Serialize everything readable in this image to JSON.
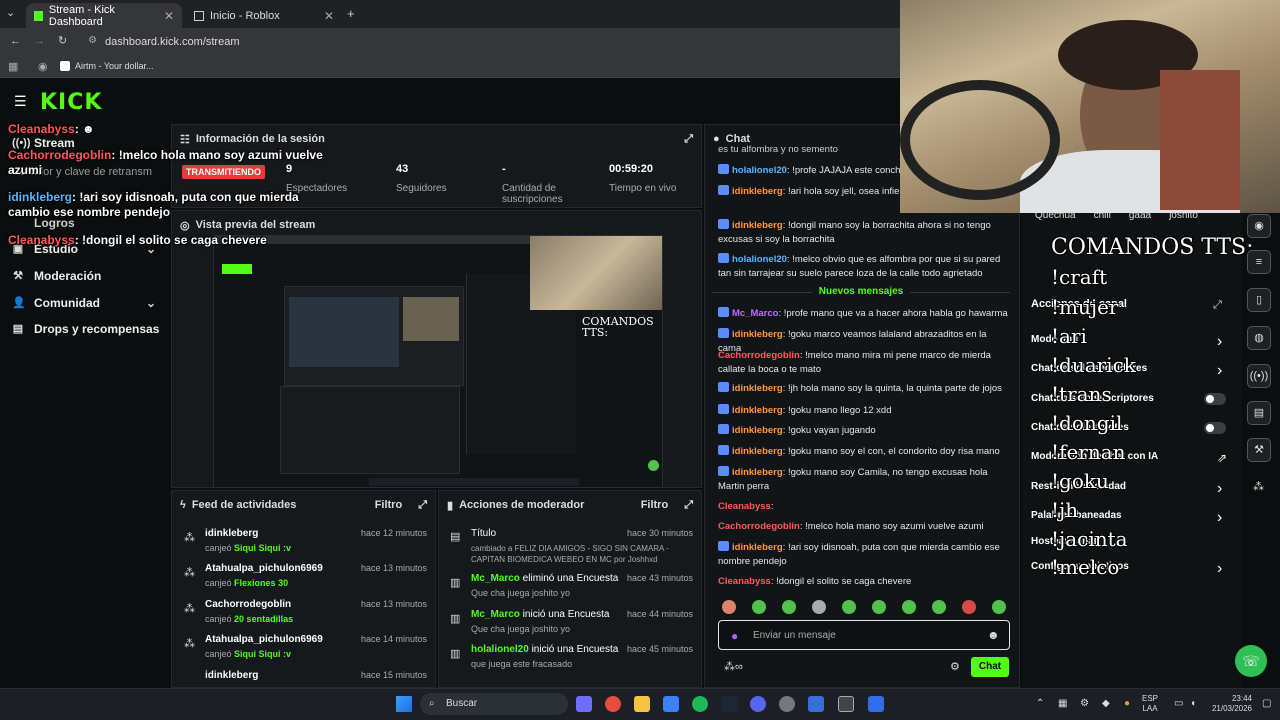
{
  "browser": {
    "tabs": [
      {
        "label": "Stream - Kick Dashboard"
      },
      {
        "label": "Inicio - Roblox"
      }
    ],
    "url": "dashboard.kick.com/stream",
    "bookmark": "Airtm - Your dollar..."
  },
  "kick": {
    "logo": "KICK"
  },
  "sidebar": {
    "items": [
      {
        "label": "Stream"
      },
      {
        "label": "Estudio"
      },
      {
        "label": "Moderación"
      },
      {
        "label": "Comunidad"
      },
      {
        "label": "Drops y recompensas"
      }
    ],
    "partial": [
      "Logros",
      "Servidor y clave de retransm"
    ]
  },
  "session": {
    "title": "Información de la sesión",
    "status": "TRANSMITIENDO",
    "stats": [
      {
        "value": "9",
        "label": "Espectadores"
      },
      {
        "value": "43",
        "label": "Seguidores"
      },
      {
        "value": "-",
        "label": "Cantidad de suscripciones"
      },
      {
        "value": "00:59:20",
        "label": "Tiempo en vivo"
      }
    ]
  },
  "preview": {
    "title": "Vista previa del stream",
    "tts_title": "COMANDOS TTS:"
  },
  "overlay_chat": [
    {
      "user": "Cleanabyss",
      "text": ":"
    },
    {
      "user": "Cachorrodegoblin",
      "text": "!melco hola mano soy azumi vuelve azumi"
    },
    {
      "user": "idinkleberg",
      "text": "!ari soy idisnoah, puta con que mierda cambio ese nombre pendejo"
    },
    {
      "user": "Cleanabyss",
      "text": "!dongil el solito se caga chevere"
    }
  ],
  "feed": {
    "title": "Feed de actividades",
    "filter": "Filtro",
    "items": [
      {
        "name": "idinkleberg",
        "prefix": "canjeó",
        "reward": "Siqui Siqui :v",
        "time": "hace 12 minutos"
      },
      {
        "name": "Atahualpa_pichulon6969",
        "prefix": "canjeó",
        "reward": "Flexiones 30",
        "time": "hace 13 minutos"
      },
      {
        "name": "Cachorrodegoblin",
        "prefix": "canjeó",
        "reward": "20 sentadillas",
        "time": "hace 13 minutos"
      },
      {
        "name": "Atahualpa_pichulon6969",
        "prefix": "canjeó",
        "reward": "Siqui Siqui :v",
        "time": "hace 14 minutos"
      },
      {
        "name": "idinkleberg",
        "prefix": "",
        "reward": "",
        "time": "hace 15 minutos"
      }
    ]
  },
  "modactions": {
    "title": "Acciones de moderador",
    "filter": "Filtro",
    "items": [
      {
        "user": "Título",
        "action": "",
        "sub": "cambiado a FELIZ DIA AMIGOS - SIGO SIN CAMARA - CAPITAN BIOMEDICA WEBEO EN MC por Joshhxd",
        "time": "hace 30 minutos"
      },
      {
        "user": "Mc_Marco",
        "action": " eliminó una Encuesta",
        "sub": "Que cha juega joshito yo",
        "time": "hace 43 minutos"
      },
      {
        "user": "Mc_Marco",
        "action": " inició una Encuesta",
        "sub": "Que cha juega joshito yo",
        "time": "hace 44 minutos"
      },
      {
        "user": "holalionel20",
        "action": " inició una Encuesta",
        "sub": "que juega este fracasado",
        "time": "hace 45 minutos"
      }
    ]
  },
  "chat": {
    "title": "Chat",
    "top_partial": "es tu alfombra y no semento",
    "new_messages": "Nuevos mensajes",
    "messages": [
      {
        "user": "holalionel20",
        "text": ": !profe JAJAJA este concha",
        "color": "#57b6ff"
      },
      {
        "user": "idinkleberg",
        "text": ": !ari hola soy jell, osea infierno! 50 puntos uve",
        "color": "#ff9a3c"
      },
      {
        "user": "idinkleberg",
        "text": ": !dongil mano soy la borrachita ahora si no tengo excusas si soy la borrachita",
        "color": "#ff9a3c"
      },
      {
        "user": "holalionel20",
        "text": ": !melco obvio que es alfombra por que si su pared tan sin tarrajear su suelo parece loza de la calle todo agrietado",
        "color": "#57b6ff"
      },
      {
        "user": "Mc_Marco",
        "text": ": !profe mano que va a hacer ahora habla go hawarma",
        "color": "#c06bff"
      },
      {
        "user": "idinkleberg",
        "text": ": !goku marco veamos lalaland abrazaditos en la cama",
        "color": "#ff9a3c"
      },
      {
        "user": "Cachorrodegoblin",
        "text": ": !melco mano mira mi pene marco de mierda callate la boca o te mato",
        "color": "#ff5a5a"
      },
      {
        "user": "idinkleberg",
        "text": ": !jh hola mano soy la quinta, la quinta parte de jojos",
        "color": "#ff9a3c"
      },
      {
        "user": "idinkleberg",
        "text": ": !goku mano llego 12 xdd",
        "color": "#ff9a3c"
      },
      {
        "user": "idinkleberg",
        "text": ": !goku vayan jugando",
        "color": "#ff9a3c"
      },
      {
        "user": "idinkleberg",
        "text": ": !goku mano soy el con, el condorito doy risa mano",
        "color": "#ff9a3c"
      },
      {
        "user": "idinkleberg",
        "text": ": !goku mano soy Camila, no tengo excusas hola Martin perra",
        "color": "#ff9a3c"
      },
      {
        "user": "Cleanabyss",
        "text": ":",
        "color": "#ff5a5a"
      },
      {
        "user": "Cachorrodegoblin",
        "text": ": !melco hola mano soy azumi vuelve azumi",
        "color": "#ff5a5a"
      },
      {
        "user": "idinkleberg",
        "text": ": !ari soy idisnoah, puta con que mierda cambio ese nombre pendejo",
        "color": "#ff9a3c"
      },
      {
        "user": "Cleanabyss",
        "text": ": !dongil el solito se caga chevere",
        "color": "#ff5a5a"
      }
    ],
    "input_placeholder": "Enviar un mensaje",
    "send_label": "Chat"
  },
  "channel": {
    "top_words": [
      "Quechua",
      "chill",
      "gaaa",
      "joshito"
    ],
    "title": "Acciones de canal",
    "items": [
      {
        "label": "Modo anti",
        "control": "arrow"
      },
      {
        "label": "Chat de solo seguidores",
        "control": "arrow"
      },
      {
        "label": "Chat de solo suscriptores",
        "control": "toggle"
      },
      {
        "label": "Chat de solo emotes",
        "control": "toggle"
      },
      {
        "label": "Moderación de chat con IA",
        "control": "link"
      },
      {
        "label": "Restricción de edad",
        "control": "arrow"
      },
      {
        "label": "Palabras baneadas",
        "control": "arrow"
      },
      {
        "label": "Hostear canal",
        "control": "none"
      },
      {
        "label": "Configurar objetivos",
        "control": "arrow"
      }
    ],
    "tts": [
      "COMANDOS TTS:",
      "!craft",
      "!mujer",
      "!ari",
      "!duarick",
      "!trans",
      "!dongil",
      "!fernan",
      "!goku",
      "!jh",
      "!jacinta",
      "!melco"
    ]
  },
  "taskbar": {
    "search": "Buscar",
    "lang": "ESP",
    "lang2": "LAA",
    "time": "23:44",
    "date": "21/03/2026"
  },
  "colors": {
    "accent": "#53fc18",
    "bg": "#0b0e0f",
    "panel": "#16191b"
  }
}
